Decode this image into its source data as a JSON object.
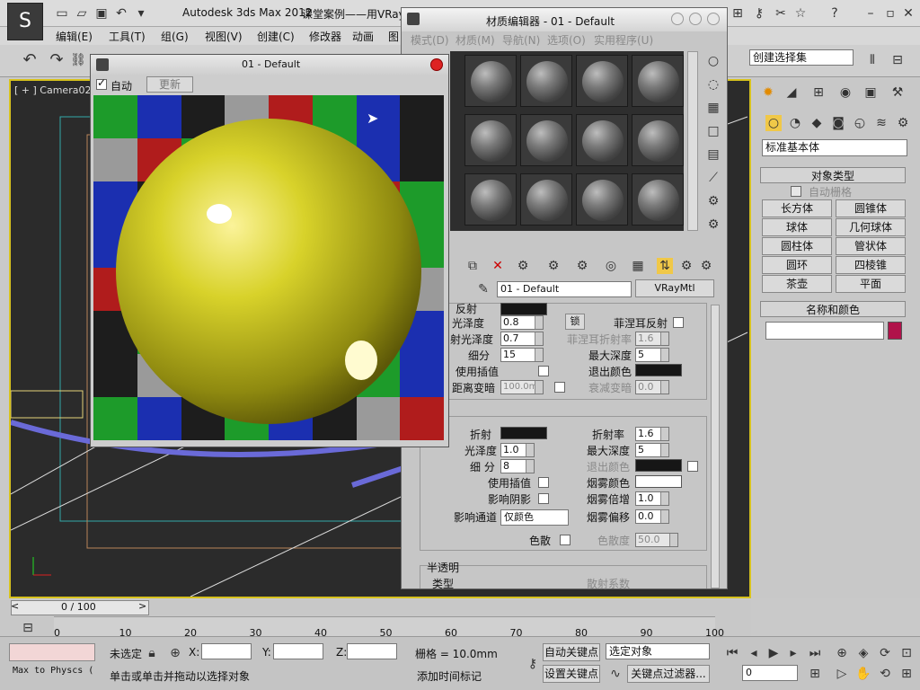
{
  "app": {
    "title": "Autodesk 3ds Max  2012",
    "doc_title": "课堂案例——用VRay",
    "logo_glyph": "S"
  },
  "menus": [
    "编辑(E)",
    "工具(T)",
    "组(G)",
    "视图(V)",
    "创建(C)",
    "修改器",
    "动画",
    "图"
  ],
  "viewport": {
    "label": "[ + ] Camera02"
  },
  "preview": {
    "title": "01 - Default",
    "auto_label": "自动",
    "update_label": "更新",
    "checker_colors": [
      "#1d9b2a",
      "#1b2fb0",
      "#1d1d1d",
      "#9a9a9a",
      "#b01c1c",
      "#1d9b2a",
      "#1b2fb0",
      "#1d1d1d"
    ]
  },
  "material_editor": {
    "title": "材质编辑器 - 01 - Default",
    "menus": [
      "模式(D)",
      "材质(M)",
      "导航(N)",
      "选项(O)",
      "实用程序(U)"
    ],
    "material_name": "01 - Default",
    "material_type": "VRayMtl",
    "reflection": {
      "title": "反射",
      "gloss_label": "光泽度",
      "gloss_value": "0.8",
      "lock_label": "锁",
      "fresnel_label": "菲涅耳反射",
      "refl_gloss_label": "射光泽度",
      "refl_gloss_value": "0.7",
      "fresnel_ior_label": "菲涅耳折射率",
      "fresnel_ior_value": "1.6",
      "subdiv_label": "细分",
      "subdiv_value": "15",
      "max_depth_label": "最大深度",
      "max_depth_value": "5",
      "interp_label": "使用插值",
      "exit_color_label": "退出颜色",
      "dim_dist_label": "距离变暗",
      "dim_dist_value": "100.0m",
      "dim_falloff_label": "衰减变暗",
      "dim_falloff_value": "0.0"
    },
    "refraction": {
      "title": "折射",
      "ior_label": "折射率",
      "ior_value": "1.6",
      "gloss_label": "光泽度",
      "gloss_value": "1.0",
      "max_depth_label": "最大深度",
      "max_depth_value": "5",
      "subdiv_label": "细 分",
      "subdiv_value": "8",
      "exit_color_label": "退出颜色",
      "interp_label": "使用插值",
      "fog_color_label": "烟雾颜色",
      "shadow_label": "影响阴影",
      "fog_mult_label": "烟雾倍增",
      "fog_mult_value": "1.0",
      "affect_channel_label": "影响通道",
      "affect_channel_value": "仅颜色",
      "fog_bias_label": "烟雾偏移",
      "fog_bias_value": "0.0",
      "dispersion_label": "色散",
      "abbe_label": "色散度",
      "abbe_value": "50.0"
    },
    "translucency": {
      "title": "半透明",
      "type_label": "类型",
      "scatter_label": "散射系数"
    }
  },
  "command_panel": {
    "category": "标准基本体",
    "rollout_object_type": "对象类型",
    "auto_grid": "自动栅格",
    "objects": [
      "长方体",
      "圆锥体",
      "球体",
      "几何球体",
      "圆柱体",
      "管状体",
      "圆环",
      "四棱锥",
      "茶壶",
      "平面"
    ],
    "rollout_name_color": "名称和颜色",
    "color": "#b0124a"
  },
  "toolbar": {
    "selection_set": "创建选择集"
  },
  "timeline": {
    "frame_display": "0 / 100",
    "ticks": [
      "0",
      "10",
      "20",
      "30",
      "40",
      "50",
      "60",
      "70",
      "80",
      "90",
      "100"
    ]
  },
  "status": {
    "script_label": "Max to Physcs (",
    "selection": "未选定",
    "x_label": "X:",
    "y_label": "Y:",
    "z_label": "Z:",
    "grid": "栅格 = 10.0mm",
    "auto_key": "自动关键点",
    "set_key": "设置关键点",
    "selected_object": "选定对象",
    "key_filters": "关键点过滤器...",
    "frame": "0",
    "prompt": "单击或单击并拖动以选择对象",
    "add_time_tag": "添加时间标记"
  }
}
